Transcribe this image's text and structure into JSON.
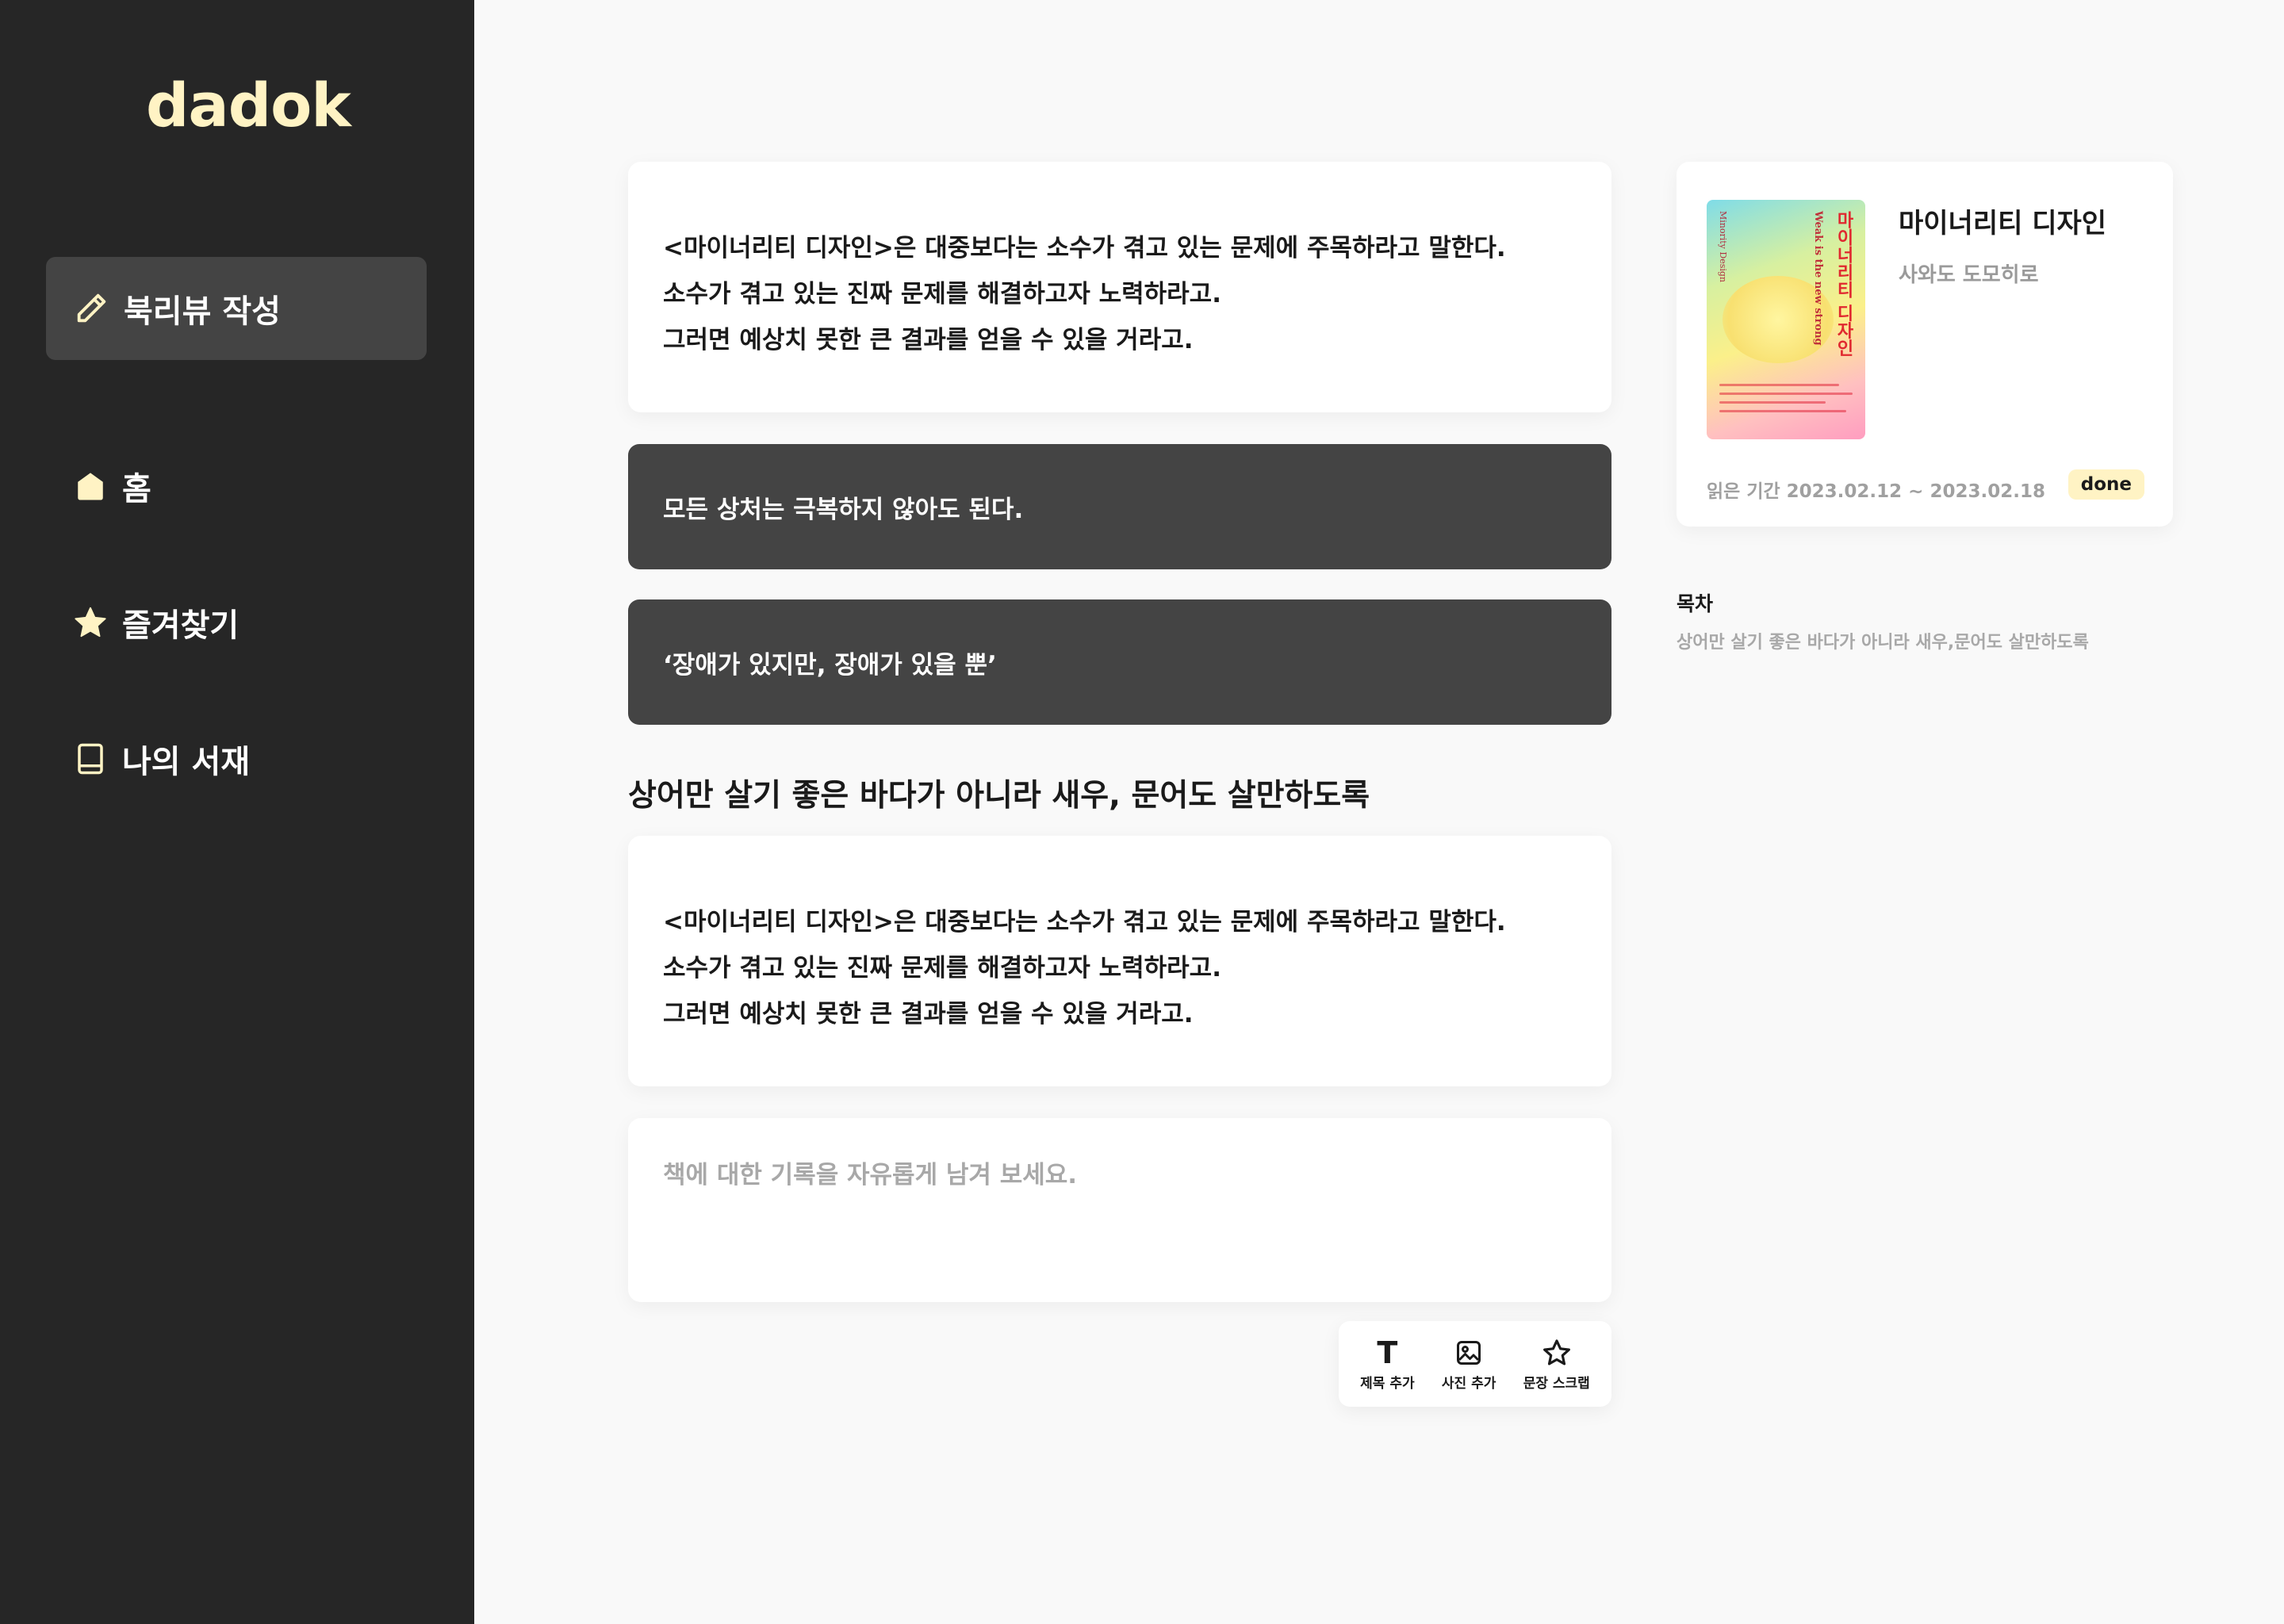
{
  "app": {
    "logo": "dadok"
  },
  "sidebar": {
    "write_button": "북리뷰 작성",
    "items": [
      {
        "label": "홈",
        "icon": "home-icon"
      },
      {
        "label": "즐겨찾기",
        "icon": "star-icon"
      },
      {
        "label": "나의 서재",
        "icon": "book-icon"
      }
    ]
  },
  "main": {
    "quote_cards": [
      {
        "lines": [
          "<마이너리티 디자인>은 대중보다는 소수가 겪고 있는 문제에 주목하라고 말한다.",
          "소수가 겪고 있는 진짜 문제를 해결하고자 노력하라고.",
          "그러면 예상치 못한 큰 결과를 얻을 수 있을 거라고."
        ]
      },
      {
        "lines": [
          "<마이너리티 디자인>은 대중보다는 소수가 겪고 있는 문제에 주목하라고 말한다.",
          "소수가 겪고 있는 진짜 문제를 해결하고자 노력하라고.",
          "그러면 예상치 못한 큰 결과를 얻을 수 있을 거라고."
        ]
      }
    ],
    "scraps": [
      "모든 상처는 극복하지 않아도 된다.",
      "‘장애가 있지만, 장애가 있을 뿐’"
    ],
    "section_title": "상어만 살기 좋은 바다가 아니라 새우, 문어도 살만하도록",
    "editor_placeholder": "책에 대한 기록을 자유롭게 남겨 보세요.",
    "toolbar": {
      "add_title": "제목 추가",
      "add_photo": "사진 추가",
      "scrap_sentence": "문장 스크랩"
    }
  },
  "book": {
    "title": "마이너리티 디자인",
    "author": "사와도 도모히로",
    "read_period": "읽은 기간 2023.02.12 ~ 2023.02.18",
    "status": "done",
    "cover": {
      "title": "마이너리티 디자인",
      "subtitle": "Weak is the new strong",
      "en_title": "Minority Design"
    },
    "toc_label": "목차",
    "toc_items": [
      "상어만 살기 좋은 바다가 아니라 새우,문어도 살만하도록"
    ]
  },
  "colors": {
    "sidebar_bg": "#262626",
    "accent": "#fff3c4",
    "dark_card": "#444444",
    "page_bg": "#f9f9f9"
  }
}
